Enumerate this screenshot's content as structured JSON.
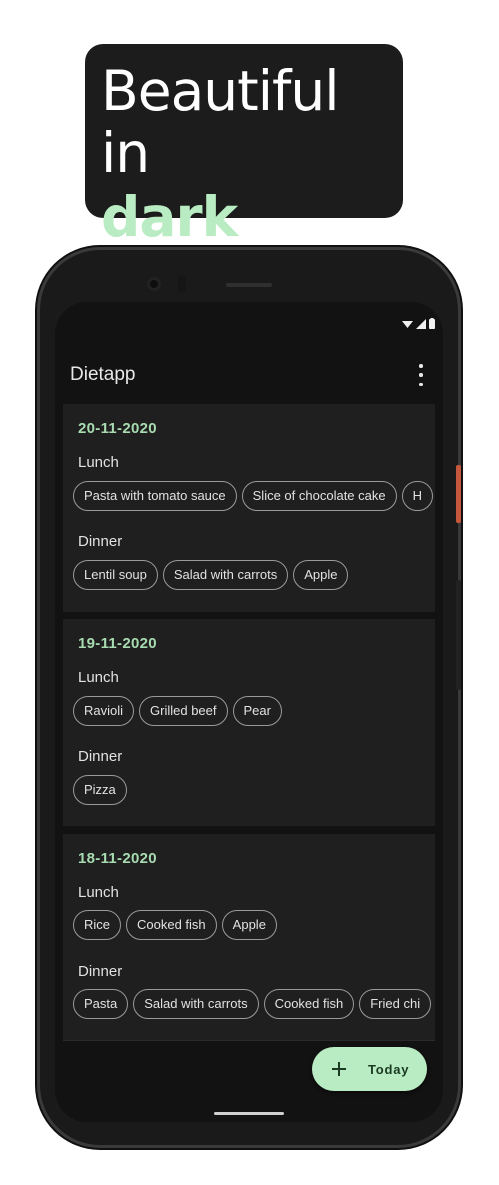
{
  "headline": {
    "line1": "Beautiful in",
    "line2": "dark"
  },
  "app": {
    "title": "Dietapp"
  },
  "days": [
    {
      "date": "20-11-2020",
      "meals": [
        {
          "label": "Lunch",
          "items": [
            "Pasta with tomato sauce",
            "Slice of chocolate cake",
            "H"
          ]
        },
        {
          "label": "Dinner",
          "items": [
            "Lentil soup",
            "Salad with carrots",
            "Apple"
          ]
        }
      ]
    },
    {
      "date": "19-11-2020",
      "meals": [
        {
          "label": "Lunch",
          "items": [
            "Ravioli",
            "Grilled beef",
            "Pear"
          ]
        },
        {
          "label": "Dinner",
          "items": [
            "Pizza"
          ]
        }
      ]
    },
    {
      "date": "18-11-2020",
      "meals": [
        {
          "label": "Lunch",
          "items": [
            "Rice",
            "Cooked fish",
            "Apple"
          ]
        },
        {
          "label": "Dinner",
          "items": [
            "Pasta",
            "Salad with carrots",
            "Cooked fish",
            "Fried chi"
          ]
        }
      ]
    }
  ],
  "fab": {
    "label": "Today",
    "icon": "plus-icon"
  },
  "status_icons": [
    "wifi-icon",
    "signal-icon",
    "battery-icon"
  ],
  "colors": {
    "accent": "#b9ecc2",
    "date_text": "#a8dbb0",
    "background": "#121212",
    "surface": "#1f1f1f"
  }
}
